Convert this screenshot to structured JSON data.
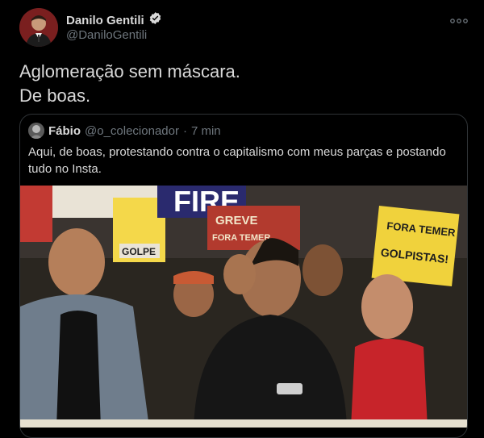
{
  "author": {
    "name": "Danilo Gentili",
    "handle": "@DaniloGentili",
    "verified": true
  },
  "tweet": {
    "lines": [
      "Aglomeração sem máscara.",
      "De boas."
    ]
  },
  "quoted": {
    "name": "Fábio",
    "handle": "@o_colecionador",
    "separator": "·",
    "time": "7 min",
    "text": "Aqui, de boas, protestando contra o capitalismo com meus parças e postando tudo no Insta."
  },
  "photo": {
    "signs": [
      "FORA TEMER",
      "GOLPISTAS!",
      "GREVE",
      "FORA TEMER",
      "FORA TEMER",
      "GOLPE",
      "FIRE"
    ]
  },
  "icons": {
    "verified": "verified-badge-icon",
    "more": "more-options-icon"
  },
  "colors": {
    "background": "#000000",
    "text": "#d9d9d9",
    "secondary": "#6e767d",
    "border": "#2f3336"
  }
}
